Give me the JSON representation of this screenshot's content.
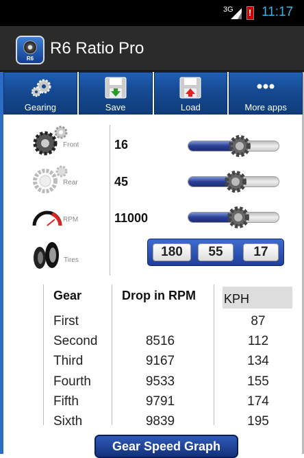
{
  "status_bar": {
    "network": "3G",
    "time": "11:17"
  },
  "app": {
    "title": "R6 Ratio Pro",
    "icon_text": "R6"
  },
  "toolbar": [
    {
      "label": "Gearing",
      "icon": "gears-icon"
    },
    {
      "label": "Save",
      "icon": "save-icon"
    },
    {
      "label": "Load",
      "icon": "load-icon"
    },
    {
      "label": "More apps",
      "icon": "more-dots-icon"
    }
  ],
  "params": {
    "front": {
      "label": "Front",
      "value": "16",
      "slider_fraction": 0.57
    },
    "rear": {
      "label": "Rear",
      "value": "45",
      "slider_fraction": 0.52
    },
    "rpm": {
      "label": "RPM",
      "value": "11000",
      "slider_fraction": 0.55
    },
    "tires": {
      "label": "Tires",
      "width": "180",
      "aspect": "55",
      "rim": "17"
    }
  },
  "table": {
    "headers": {
      "gear": "Gear",
      "drop": "Drop in RPM",
      "unit": "KPH"
    },
    "rows": [
      {
        "gear": "First",
        "drop": "",
        "speed": "87"
      },
      {
        "gear": "Second",
        "drop": "8516",
        "speed": "112"
      },
      {
        "gear": "Third",
        "drop": "9167",
        "speed": "134"
      },
      {
        "gear": "Fourth",
        "drop": "9533",
        "speed": "155"
      },
      {
        "gear": "Fifth",
        "drop": "9791",
        "speed": "174"
      },
      {
        "gear": "Sixth",
        "drop": "9839",
        "speed": "195"
      }
    ]
  },
  "graph_button": {
    "label": "Gear Speed Graph"
  },
  "colors": {
    "accent": "#1f4fa8",
    "time": "#33b5e5"
  }
}
